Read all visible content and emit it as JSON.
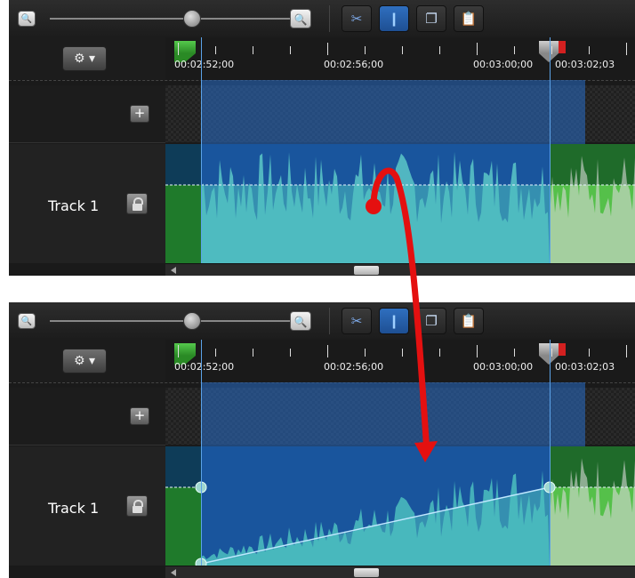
{
  "toolbar": {
    "zoom_out_icon": "magnifier-minus-icon",
    "zoom_in_icon": "magnifier-plus-icon",
    "zoom_level": 0.6,
    "tools": [
      "cut-icon",
      "split-icon",
      "copy-icon",
      "paste-icon"
    ]
  },
  "timeline": {
    "time_labels": [
      "00:02:52;00",
      "00:02:56;00",
      "00:03:00;00",
      "00:03:02;03"
    ],
    "settings_icon": "gear-icon",
    "add_track_icon": "plus-icon",
    "track_name": "Track 1",
    "lock_icon": "lock-icon"
  },
  "panels": [
    {
      "id": "before",
      "volume": "flat"
    },
    {
      "id": "after",
      "volume": "ramp"
    }
  ],
  "colors": {
    "selection": "#2a6ec8",
    "waveform": "#4cbfbf",
    "clip_green": "#55c04a",
    "arrow": "#e41010"
  }
}
